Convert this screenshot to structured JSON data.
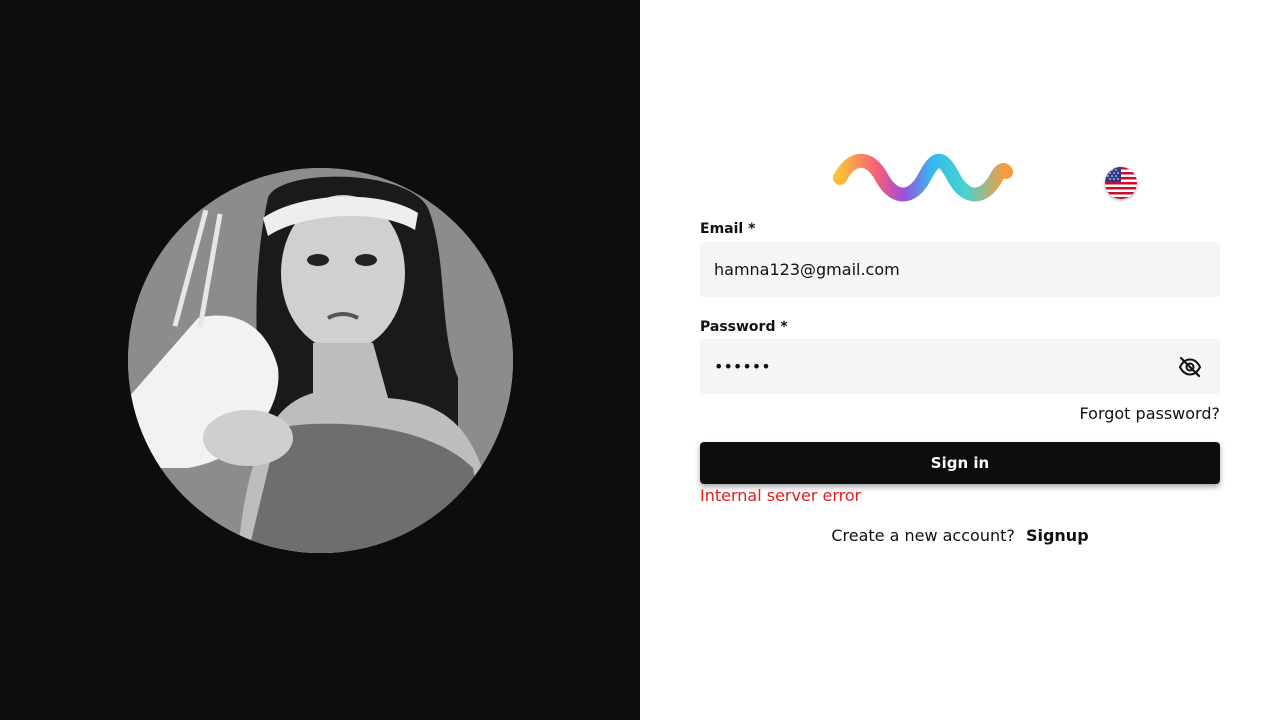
{
  "hero": {
    "image": "portrait-photo-woman-with-hand-mixer"
  },
  "header": {
    "logo_icon": "wave-logo",
    "language_icon": "us-flag-icon"
  },
  "form": {
    "email": {
      "label": "Email *",
      "value": "hamna123@gmail.com"
    },
    "password": {
      "label": "Password *",
      "value": "••••••",
      "toggle_icon": "eye-off-icon"
    },
    "forgot_label": "Forgot password?",
    "submit_label": "Sign in",
    "error_text": "Internal server error",
    "signup_prompt": "Create a new account?",
    "signup_link": "Signup"
  },
  "colors": {
    "dark_panel": "#0d0d0d",
    "input_bg": "#f5f5f5",
    "button_bg": "#0d0d0d",
    "error": "#e31b1b"
  }
}
